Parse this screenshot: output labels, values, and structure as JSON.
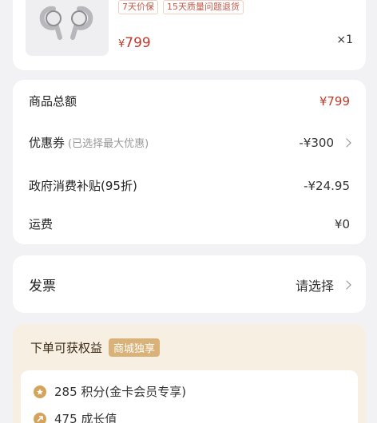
{
  "product": {
    "tags": [
      "7天价保",
      "15天质量问题退货"
    ],
    "price_symbol": "¥",
    "price": "799",
    "quantity": "×1"
  },
  "summary": {
    "total_label": "商品总额",
    "total_value": "¥799",
    "coupon_label": "优惠券",
    "coupon_hint": "(已选择最大优惠)",
    "coupon_value": "-¥300",
    "subsidy_label": "政府消费补贴(95折)",
    "subsidy_value": "-¥24.95",
    "shipping_label": "运费",
    "shipping_value": "¥0"
  },
  "invoice": {
    "label": "发票",
    "value": "请选择"
  },
  "benefits": {
    "title": "下单可获权益",
    "badge": "商城独享",
    "items": [
      {
        "text": "285 积分(金卡会员专享)",
        "icon": "points-coin-icon"
      },
      {
        "text": "475 成长值",
        "icon": "growth-value-icon"
      }
    ]
  },
  "colors": {
    "accent_red": "#c0392b",
    "benefit_bg": "#f7efe2",
    "badge_gold": "#d9b27a"
  }
}
